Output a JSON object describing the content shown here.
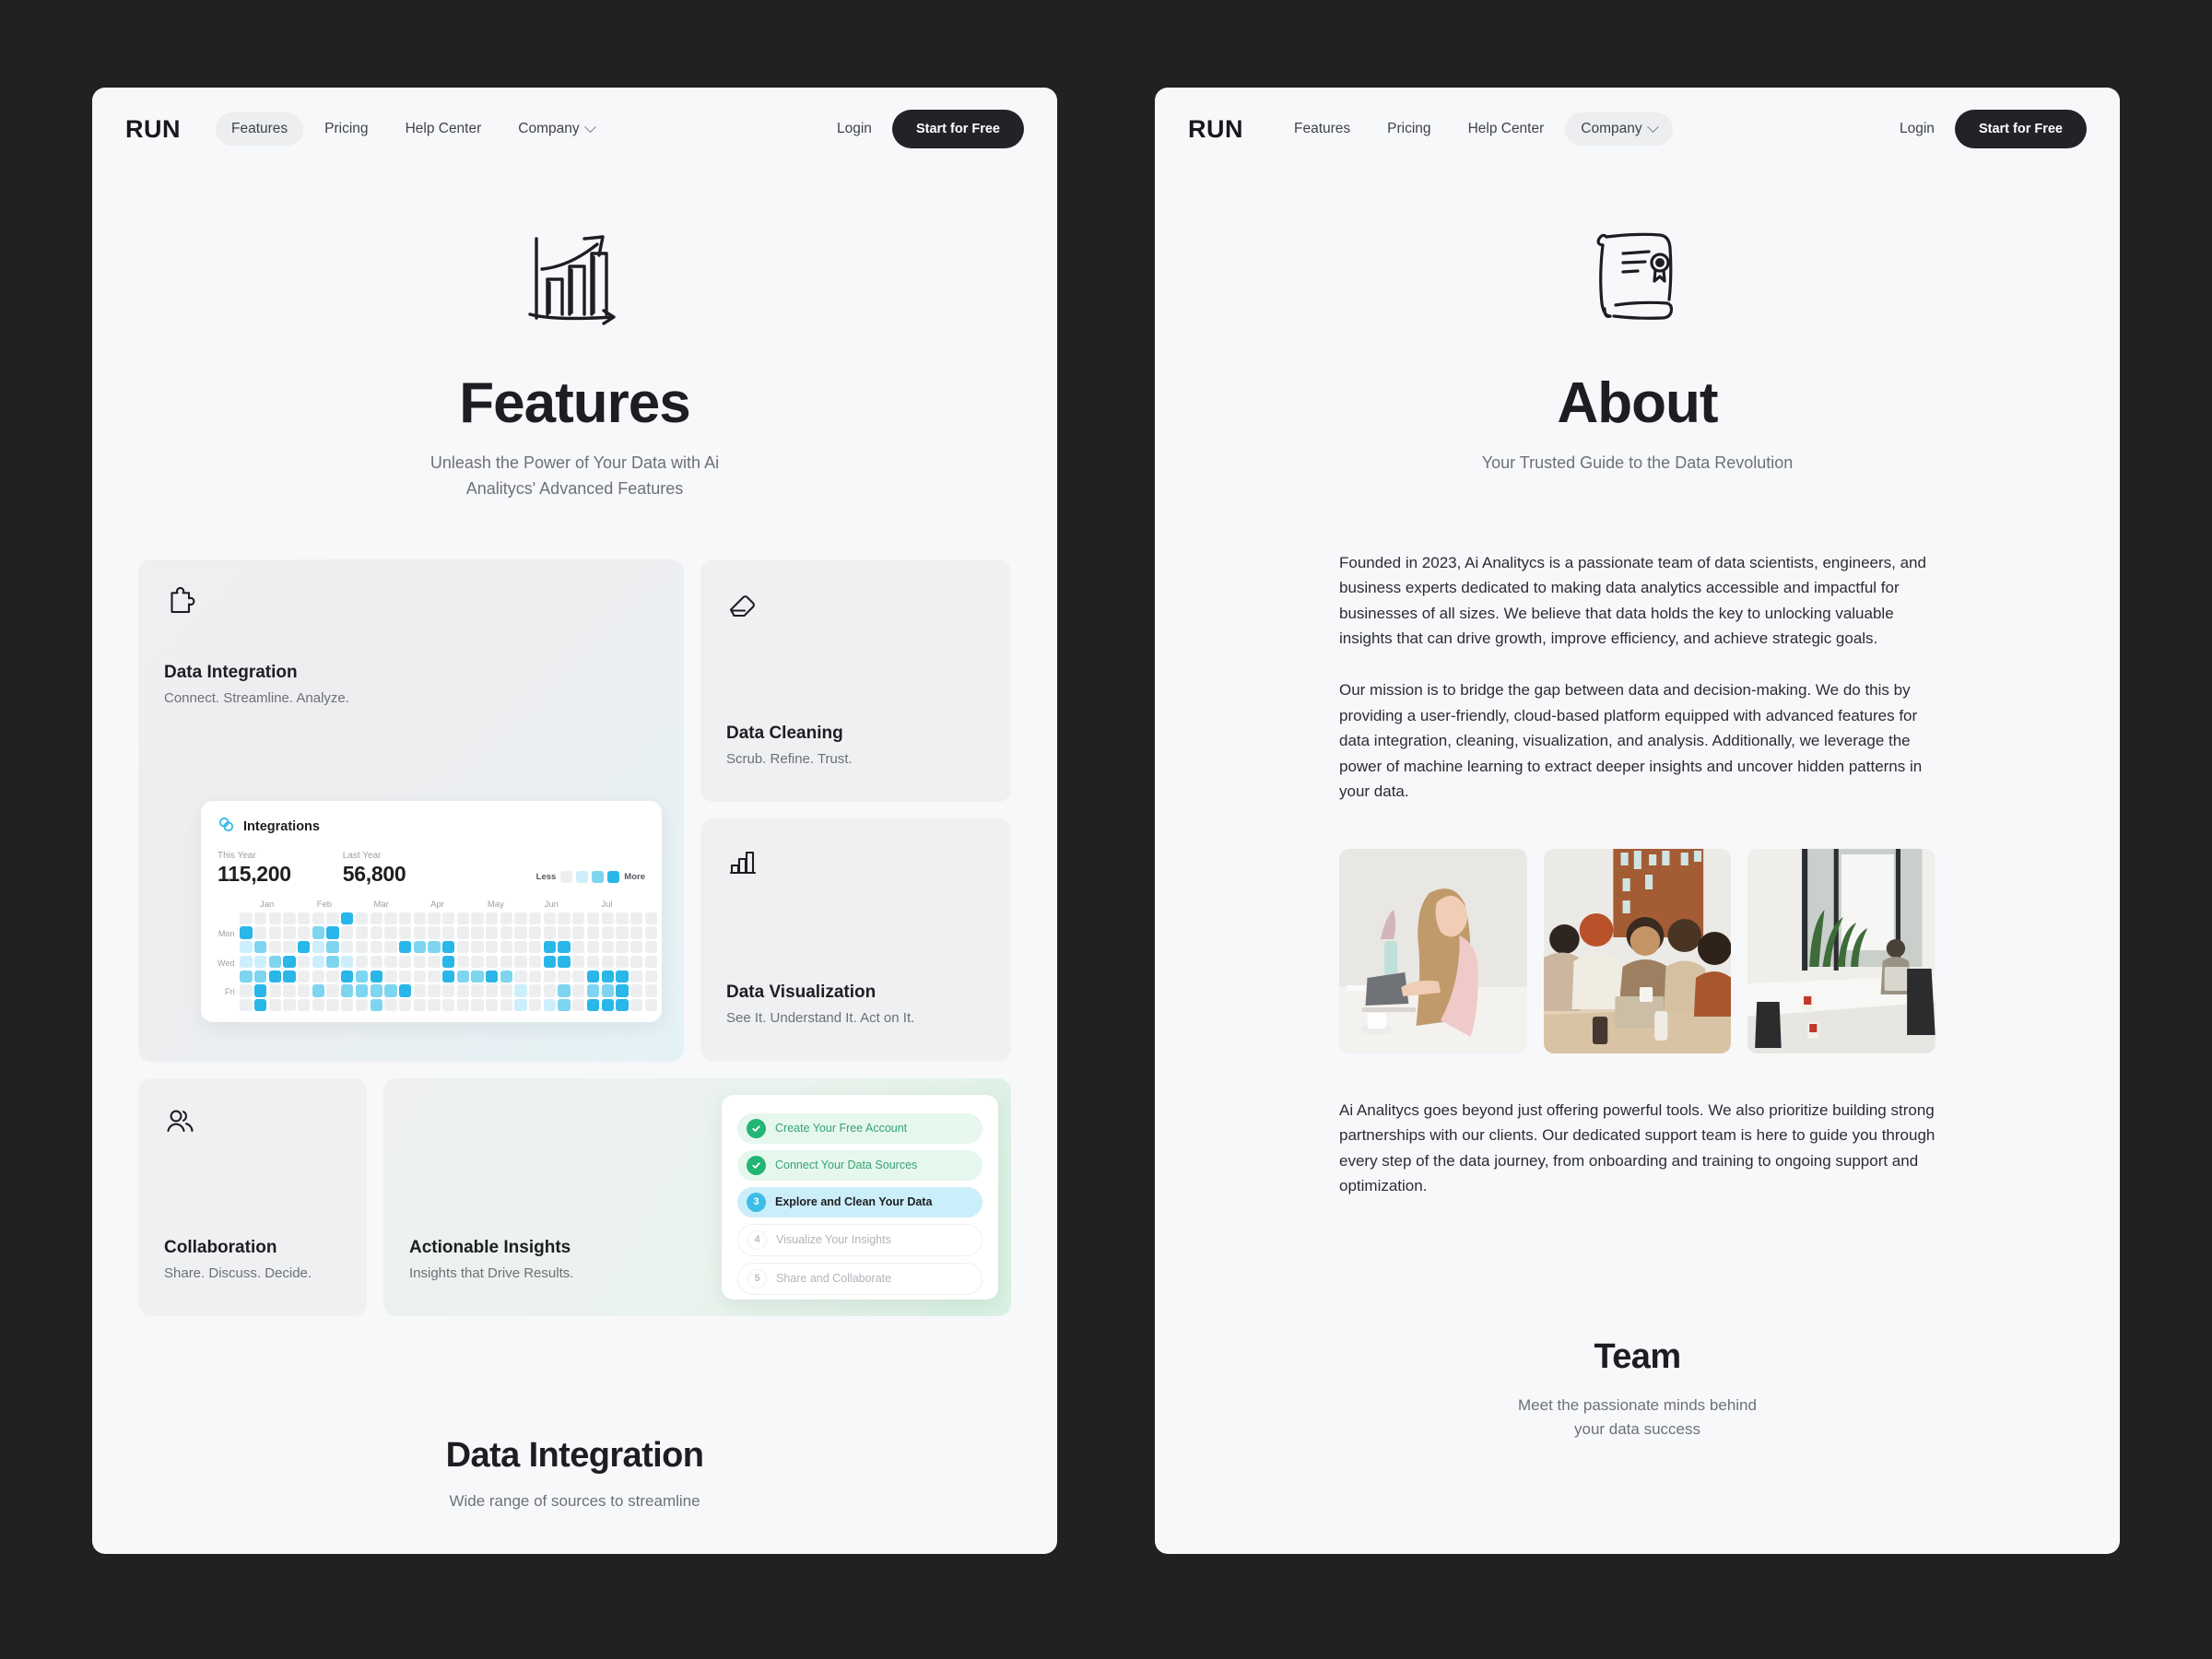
{
  "brand": {
    "logo": "RUN",
    "accent_cyan": "#29b6e8",
    "accent_green": "#22b573",
    "dark": "#222327"
  },
  "canvas": {
    "background": "#212124",
    "page_background": "#f7f8fa"
  },
  "nav": {
    "links": [
      {
        "label": "Features",
        "has_chevron": false
      },
      {
        "label": "Pricing",
        "has_chevron": false
      },
      {
        "label": "Help Center",
        "has_chevron": false
      },
      {
        "label": "Company",
        "has_chevron": true
      }
    ],
    "login_label": "Login",
    "cta_label": "Start for Free",
    "active_left": "Features",
    "active_right": "Company"
  },
  "features_page": {
    "hero": {
      "icon": "bar-chart-growth-sketch-icon",
      "title": "Features",
      "subtitle_line1": "Unleash the Power of Your Data with Ai",
      "subtitle_line2": "Analitycs' Advanced Features"
    },
    "cards": {
      "integration": {
        "icon": "puzzle-piece-icon",
        "title": "Data Integration",
        "desc": "Connect. Streamline. Analyze."
      },
      "cleaning": {
        "icon": "eraser-icon",
        "title": "Data Cleaning",
        "desc": "Scrub. Refine. Trust."
      },
      "visualization": {
        "icon": "bar-chart-icon",
        "title": "Data Visualization",
        "desc": "See It. Understand It. Act on It."
      },
      "collaboration": {
        "icon": "users-icon",
        "title": "Collaboration",
        "desc": "Share. Discuss. Decide."
      },
      "insights": {
        "title": "Actionable Insights",
        "desc": "Insights that Drive Results."
      }
    },
    "integrations_widget": {
      "icon": "linked-circles-icon",
      "title": "Integrations",
      "stats": [
        {
          "label": "This Year",
          "value": "115,200"
        },
        {
          "label": "Last Year",
          "value": "56,800"
        }
      ],
      "legend": {
        "less": "Less",
        "more": "More",
        "swatches": [
          "#eceef0",
          "#cdeefb",
          "#7ed5f0",
          "#29b6e8"
        ]
      }
    },
    "checklist": [
      {
        "marker": "check",
        "label": "Create Your Free Account",
        "state": "done"
      },
      {
        "marker": "check",
        "label": "Connect Your Data Sources",
        "state": "done"
      },
      {
        "marker": "3",
        "label": "Explore and Clean Your Data",
        "state": "current"
      },
      {
        "marker": "4",
        "label": "Visualize Your Insights",
        "state": "todo"
      },
      {
        "marker": "5",
        "label": "Share and Collaborate",
        "state": "todo"
      }
    ],
    "bottom_section": {
      "title": "Data Integration",
      "subtitle": "Wide range of sources to streamline"
    }
  },
  "about_page": {
    "hero": {
      "icon": "scroll-certificate-sketch-icon",
      "title": "About",
      "subtitle": "Your Trusted Guide to the Data Revolution"
    },
    "paragraphs": [
      "Founded in 2023, Ai Analitycs is a passionate team of data scientists, engineers, and business experts dedicated to making data analytics accessible and impactful for businesses of all sizes. We believe that data holds the key to unlocking valuable insights that can drive growth, improve efficiency, and achieve strategic goals.",
      "Our mission is to bridge the gap between data and decision-making. We do this by providing a user-friendly, cloud-based platform equipped with advanced features for data integration, cleaning, visualization, and analysis. Additionally, we leverage the power of machine learning to extract deeper insights and uncover hidden patterns in your data."
    ],
    "closing_paragraph": "Ai Analitycs goes beyond just offering powerful tools. We also prioritize building strong partnerships with our clients. Our dedicated support team is here to guide you through every step of the data journey, from onboarding and training to ongoing support and optimization.",
    "photos": [
      {
        "name": "woman-working-on-laptop-photo"
      },
      {
        "name": "team-meeting-around-table-photo"
      },
      {
        "name": "office-conference-room-photo"
      }
    ],
    "team_section": {
      "title": "Team",
      "subtitle_line1": "Meet the passionate minds behind",
      "subtitle_line2": "your data success"
    }
  },
  "chart_data": {
    "type": "heatmap",
    "title": "Integrations",
    "xlabel": "",
    "ylabel": "",
    "grid": false,
    "legend_position": "top-right",
    "month_labels": [
      "Jan",
      "Feb",
      "Mar",
      "Apr",
      "May",
      "Jun",
      "Jul"
    ],
    "day_labels": [
      "",
      "Mon",
      "",
      "Wed",
      "",
      "Fri",
      ""
    ],
    "levels": [
      0,
      1,
      2,
      3
    ],
    "level_colors": [
      "#eceef0",
      "#cdeefb",
      "#7ed5f0",
      "#29b6e8"
    ],
    "columns": 29,
    "rows": 7,
    "values": [
      [
        0,
        0,
        0,
        0,
        0,
        0,
        0,
        3,
        0,
        0,
        0,
        0,
        0,
        0,
        0,
        0,
        0,
        0,
        0,
        0,
        0,
        0,
        0,
        0,
        0,
        0,
        0,
        0,
        0
      ],
      [
        3,
        0,
        0,
        0,
        0,
        2,
        3,
        0,
        0,
        0,
        0,
        0,
        0,
        0,
        0,
        0,
        0,
        0,
        0,
        0,
        0,
        0,
        0,
        0,
        0,
        0,
        0,
        0,
        0
      ],
      [
        1,
        2,
        0,
        0,
        3,
        1,
        2,
        0,
        0,
        0,
        0,
        3,
        2,
        2,
        3,
        0,
        0,
        0,
        0,
        0,
        0,
        3,
        3,
        0,
        0,
        0,
        0,
        0,
        0
      ],
      [
        1,
        1,
        2,
        3,
        0,
        1,
        2,
        1,
        0,
        0,
        0,
        0,
        0,
        0,
        3,
        0,
        0,
        0,
        0,
        0,
        0,
        3,
        3,
        0,
        0,
        0,
        0,
        0,
        0
      ],
      [
        2,
        2,
        3,
        3,
        0,
        0,
        0,
        3,
        2,
        3,
        0,
        0,
        0,
        0,
        3,
        2,
        2,
        3,
        2,
        0,
        0,
        0,
        0,
        0,
        3,
        3,
        3,
        0,
        0
      ],
      [
        0,
        3,
        0,
        0,
        0,
        2,
        0,
        2,
        2,
        2,
        2,
        3,
        0,
        0,
        0,
        0,
        0,
        0,
        0,
        1,
        0,
        0,
        2,
        0,
        2,
        2,
        3,
        0,
        0
      ],
      [
        0,
        3,
        0,
        0,
        0,
        0,
        0,
        0,
        0,
        2,
        0,
        0,
        0,
        0,
        0,
        0,
        0,
        0,
        0,
        1,
        0,
        1,
        2,
        0,
        3,
        3,
        3,
        0,
        0
      ]
    ],
    "annotations": [
      {
        "label": "This Year",
        "value": "115,200"
      },
      {
        "label": "Last Year",
        "value": "56,800"
      }
    ]
  }
}
